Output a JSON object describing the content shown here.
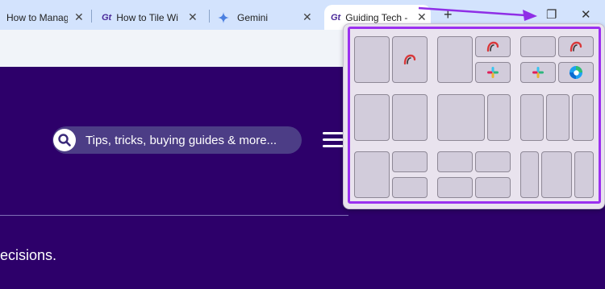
{
  "tabs": [
    {
      "label": "How to Manag",
      "icon": "none"
    },
    {
      "label": "How to Tile Wi",
      "icon": "guiding-tech-icon"
    },
    {
      "label": "Gemini",
      "icon": "gemini-sparkle-icon"
    },
    {
      "label": "Guiding Tech -",
      "icon": "guiding-tech-icon"
    }
  ],
  "tab_close_glyph": "✕",
  "new_tab_glyph": "+",
  "window": {
    "restore_glyph": "❐",
    "close_glyph": "✕"
  },
  "page": {
    "search_placeholder": "Tips, tricks, buying guides & more...",
    "tagline": "ecisions."
  },
  "snap_popup": {
    "layouts": 6,
    "app_icons": [
      "arc-icon",
      "slack-icon",
      "edge-icon"
    ]
  },
  "colors": {
    "page_bg": "#2d006a",
    "highlight": "#9b30f0",
    "tabstrip": "#d3e3fd"
  }
}
